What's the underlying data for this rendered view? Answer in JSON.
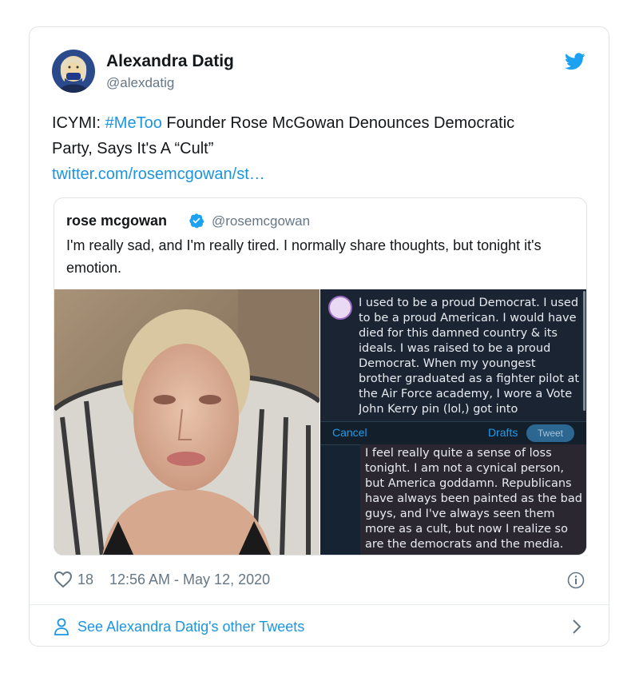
{
  "author": {
    "name": "Alexandra Datig",
    "handle": "@alexdatig"
  },
  "tweet": {
    "prefix": "ICYMI: ",
    "hashtag": "#MeToo",
    "text": " Founder Rose McGowan Denounces Democratic Party, Says It's A “Cult”",
    "link": "twitter.com/rosemcgowan/st…"
  },
  "quoted": {
    "name": "rose mcgowan",
    "handle": "@rosemcgowan",
    "text": "I'm really sad, and I'm really tired. I normally share thoughts, but tonight it's emotion."
  },
  "screenshot": {
    "note_top": "I used to be a proud Democrat. I used to be a proud American. I would have died for this damned country & its ideals. I was raised to be a proud Democrat. When my youngest brother graduated as a fighter pilot at the Air Force academy, I wore a Vote John Kerry pin (lol,) got into",
    "cancel": "Cancel",
    "drafts": "Drafts",
    "tweet_button": "Tweet",
    "note_bottom": "I feel really quite a sense of loss tonight. I am not a cynical person, but America goddamn. Republicans have always been painted as the bad guys, and I've always seen them more as a cult, but now I realize so are the democrats and the media."
  },
  "footer": {
    "likes": "18",
    "timestamp": "12:56 AM - May 12, 2020",
    "other_tweets": "See Alexandra Datig's other Tweets"
  },
  "colors": {
    "link": "#1b95e0",
    "muted": "#657786",
    "twitter_blue": "#1da1f2"
  },
  "icons": [
    "twitter-bird-icon",
    "verified-badge-icon",
    "heart-icon",
    "info-icon",
    "person-icon",
    "chevron-right-icon"
  ]
}
